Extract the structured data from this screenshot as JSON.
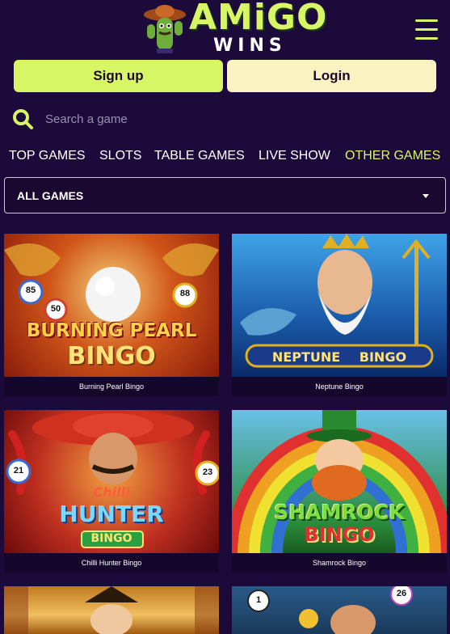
{
  "brand": {
    "name": "AMiGO",
    "sub": "WINS",
    "primary": "#d8f566",
    "bg": "#1c0a3a"
  },
  "auth": {
    "signup_label": "Sign up",
    "login_label": "Login"
  },
  "search": {
    "placeholder": "Search a game"
  },
  "nav": {
    "items": [
      {
        "label": "TOP GAMES"
      },
      {
        "label": "SLOTS"
      },
      {
        "label": "TABLE GAMES"
      },
      {
        "label": "LIVE SHOW"
      },
      {
        "label": "OTHER GAMES",
        "active": true
      }
    ]
  },
  "filter": {
    "selected": "ALL GAMES"
  },
  "games": [
    {
      "title": "Burning Pearl Bingo",
      "art_line1": "BURNING PEARL",
      "art_line2": "BINGO",
      "balls": [
        "85",
        "50",
        "88"
      ]
    },
    {
      "title": "Neptune Bingo",
      "art_line1": "NEPTUNE",
      "art_line2": "BINGO"
    },
    {
      "title": "Chilli Hunter Bingo",
      "art_line1": "Chilli",
      "art_line2": "HUNTER",
      "art_line3": "BINGO",
      "balls": [
        "21",
        "23"
      ]
    },
    {
      "title": "Shamrock Bingo",
      "art_line1": "SHAMROCK",
      "art_line2": "BINGO"
    },
    {
      "title": ""
    },
    {
      "title": "",
      "balls": [
        "1",
        "26"
      ]
    }
  ]
}
